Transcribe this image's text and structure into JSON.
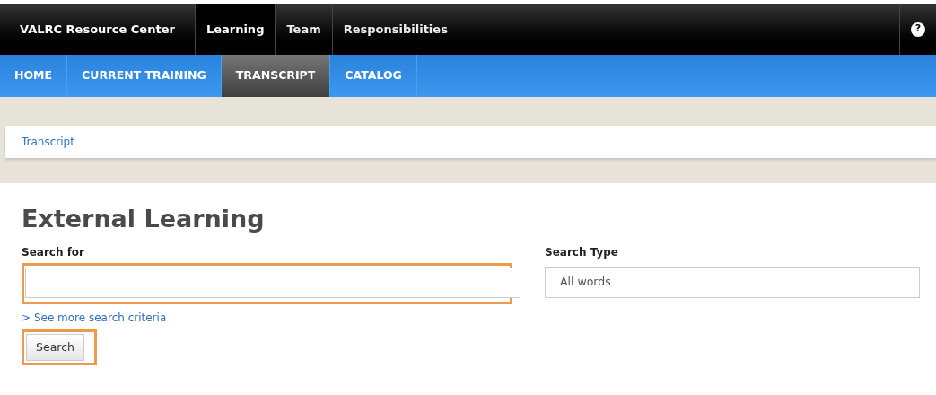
{
  "top_bar": {
    "brand": "VALRC Resource Center",
    "tabs": [
      {
        "label": "Learning",
        "selected": true
      },
      {
        "label": "Team",
        "selected": false
      },
      {
        "label": "Responsibilities",
        "selected": false
      }
    ],
    "help_icon": "?"
  },
  "sub_nav": [
    {
      "label": "HOME",
      "selected": false
    },
    {
      "label": "CURRENT TRAINING",
      "selected": false
    },
    {
      "label": "TRANSCRIPT",
      "selected": true
    },
    {
      "label": "CATALOG",
      "selected": false
    }
  ],
  "breadcrumb": "Transcript",
  "page_title": "External Learning",
  "search_for": {
    "label": "Search for",
    "highlighted": true
  },
  "search_type": {
    "label": "Search Type",
    "value": "All words"
  },
  "more_criteria": {
    "arrow": ">",
    "label": "See more search criteria"
  },
  "search_button": {
    "label": "Search",
    "highlighted": true
  }
}
